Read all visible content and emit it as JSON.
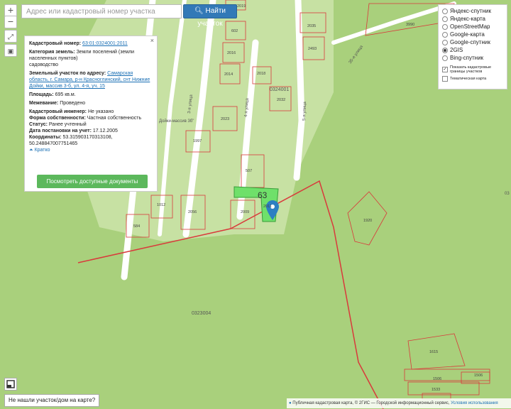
{
  "search": {
    "placeholder": "Адрес или кадастровый номер участка",
    "button_label": "Найти участок"
  },
  "zoom": {
    "plus": "+",
    "minus": "−"
  },
  "popup": {
    "close": "×",
    "cad_number_label": "Кадастровый номер:",
    "cad_number_value": "63:01:0324001:2011",
    "category_label": "Категория земель:",
    "category_value": "Земли поселений (земли населенных пунктов)",
    "category_extra": "садоводство",
    "address_label": "Земельный участок по адресу:",
    "address_value": "Самарская область, г. Самара, р-н Красноглинский, снт Нижние Дойки, массив 3-б, ул. 4-я, уч. 15",
    "area_label": "Площадь:",
    "area_value": "695 кв.м.",
    "survey_label": "Межевание:",
    "survey_value": "Проведено",
    "engineer_label": "Кадастровый инженер:",
    "engineer_value": "Не указано",
    "ownership_label": "Форма собственности:",
    "ownership_value": "Частная собственность",
    "status_label": "Статус:",
    "status_value": "Ранее учтенный",
    "date_label": "Дата постановки на учет:",
    "date_value": "17.12.2005",
    "coords_label": "Координаты:",
    "coords_value": "53.315903170313108, 50.248847007751465",
    "collapse": "Кратко",
    "docs_button": "Посмотреть доступные документы"
  },
  "layers": {
    "options": [
      {
        "label": "Яндекс-спутник",
        "selected": false
      },
      {
        "label": "Яндекс-карта",
        "selected": false
      },
      {
        "label": "OpenStreetMap",
        "selected": false
      },
      {
        "label": "Google-карта",
        "selected": false
      },
      {
        "label": "Google-спутник",
        "selected": false
      },
      {
        "label": "2GIS",
        "selected": true
      },
      {
        "label": "Bing-спутник",
        "selected": false
      }
    ],
    "show_borders": "Показать кадастровые границы участков",
    "thematic": "Тематическая карта"
  },
  "map": {
    "streets": [
      "3-я улица",
      "4-я улица",
      "5-я улица",
      "35-я улица"
    ],
    "area_label": "Дойки-массив 3б\"",
    "quarters": [
      "0324001",
      "0323004"
    ],
    "parcels": [
      "2019",
      "602",
      "2016",
      "2014",
      "2018",
      "2032",
      "2023",
      "1997",
      "507",
      "2009",
      "2056",
      "1012",
      "584",
      "1920",
      "2035",
      "2493",
      "3990",
      "1615",
      "1506",
      "1506",
      "1533",
      "2011"
    ],
    "selected_parcel": "63",
    "stray_label": "03"
  },
  "footer": {
    "not_found": "Не нашли участок/дом на карте?",
    "attribution_lead": "Публичная кадастровая карта, © 2ГИС — Городской информационный сервис, ",
    "attribution_link": "Условия использования"
  },
  "colors": {
    "map_bg": "#a9d07c",
    "road": "#ffffff",
    "parcel_border": "#d9393b",
    "selected_fill": "#6fe06a",
    "button_blue": "#3279b7",
    "button_green": "#5cb85c"
  }
}
